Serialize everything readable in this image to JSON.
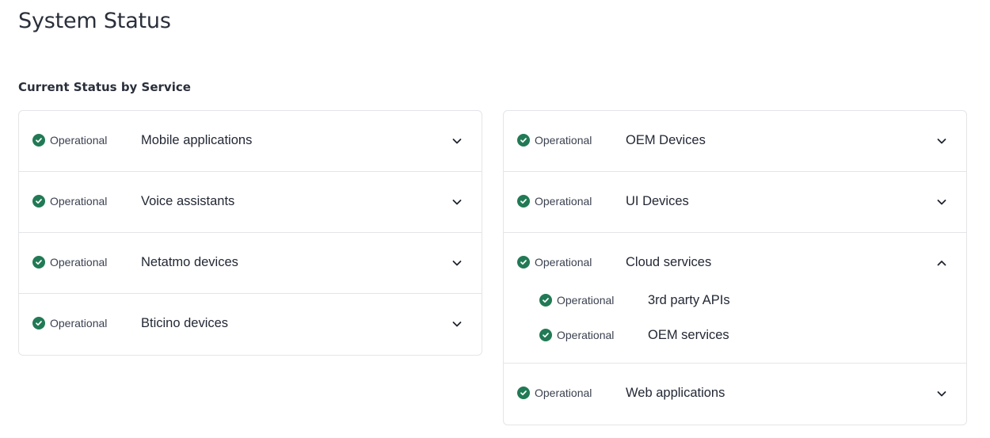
{
  "page": {
    "title": "System Status",
    "section_title": "Current Status by Service"
  },
  "colors": {
    "operational": "#217a55",
    "border": "#e3e5e8"
  },
  "left_services": [
    {
      "status": "Operational",
      "name": "Mobile applications",
      "expanded": false
    },
    {
      "status": "Operational",
      "name": "Voice assistants",
      "expanded": false
    },
    {
      "status": "Operational",
      "name": "Netatmo devices",
      "expanded": false
    },
    {
      "status": "Operational",
      "name": "Bticino devices",
      "expanded": false
    }
  ],
  "right_services": [
    {
      "status": "Operational",
      "name": "OEM Devices",
      "expanded": false
    },
    {
      "status": "Operational",
      "name": "UI Devices",
      "expanded": false
    },
    {
      "status": "Operational",
      "name": "Cloud services",
      "expanded": true,
      "children": [
        {
          "status": "Operational",
          "name": "3rd party APIs"
        },
        {
          "status": "Operational",
          "name": "OEM services"
        }
      ]
    },
    {
      "status": "Operational",
      "name": "Web applications",
      "expanded": false
    }
  ]
}
